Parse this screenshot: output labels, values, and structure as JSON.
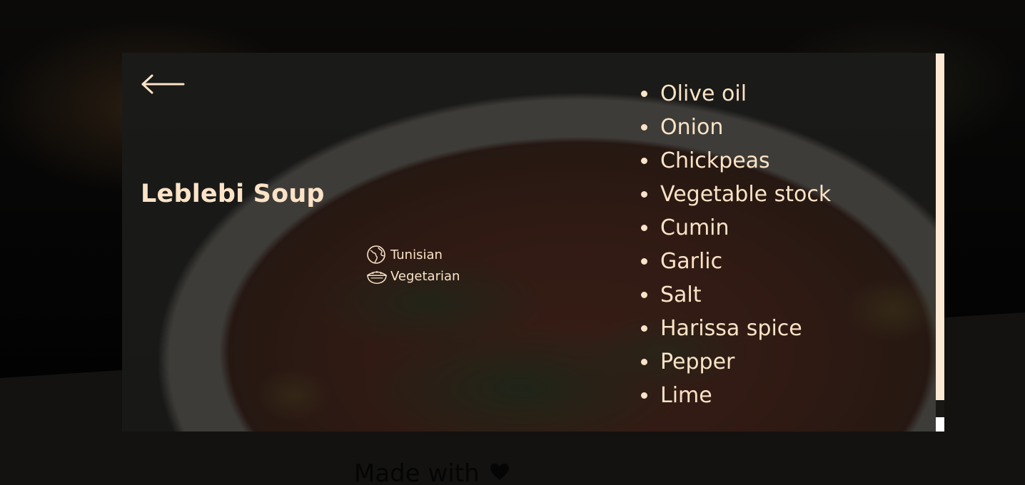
{
  "recipe": {
    "title": "Leblebi Soup",
    "tags": [
      {
        "icon": "globe-icon",
        "label": "Tunisian"
      },
      {
        "icon": "bowl-icon",
        "label": "Vegetarian"
      }
    ],
    "ingredients": [
      "Olive oil",
      "Onion",
      "Chickpeas",
      "Vegetable stock",
      "Cumin",
      "Garlic",
      "Salt",
      "Harissa spice",
      "Pepper",
      "Lime"
    ]
  },
  "footer": {
    "made_with": "Made with",
    "icon": "heart-icon"
  },
  "colors": {
    "text_accent": "#fbe3c7",
    "page_background": "#131210",
    "overlay": "#161614"
  },
  "icons": {
    "back": "arrow-left-icon"
  }
}
